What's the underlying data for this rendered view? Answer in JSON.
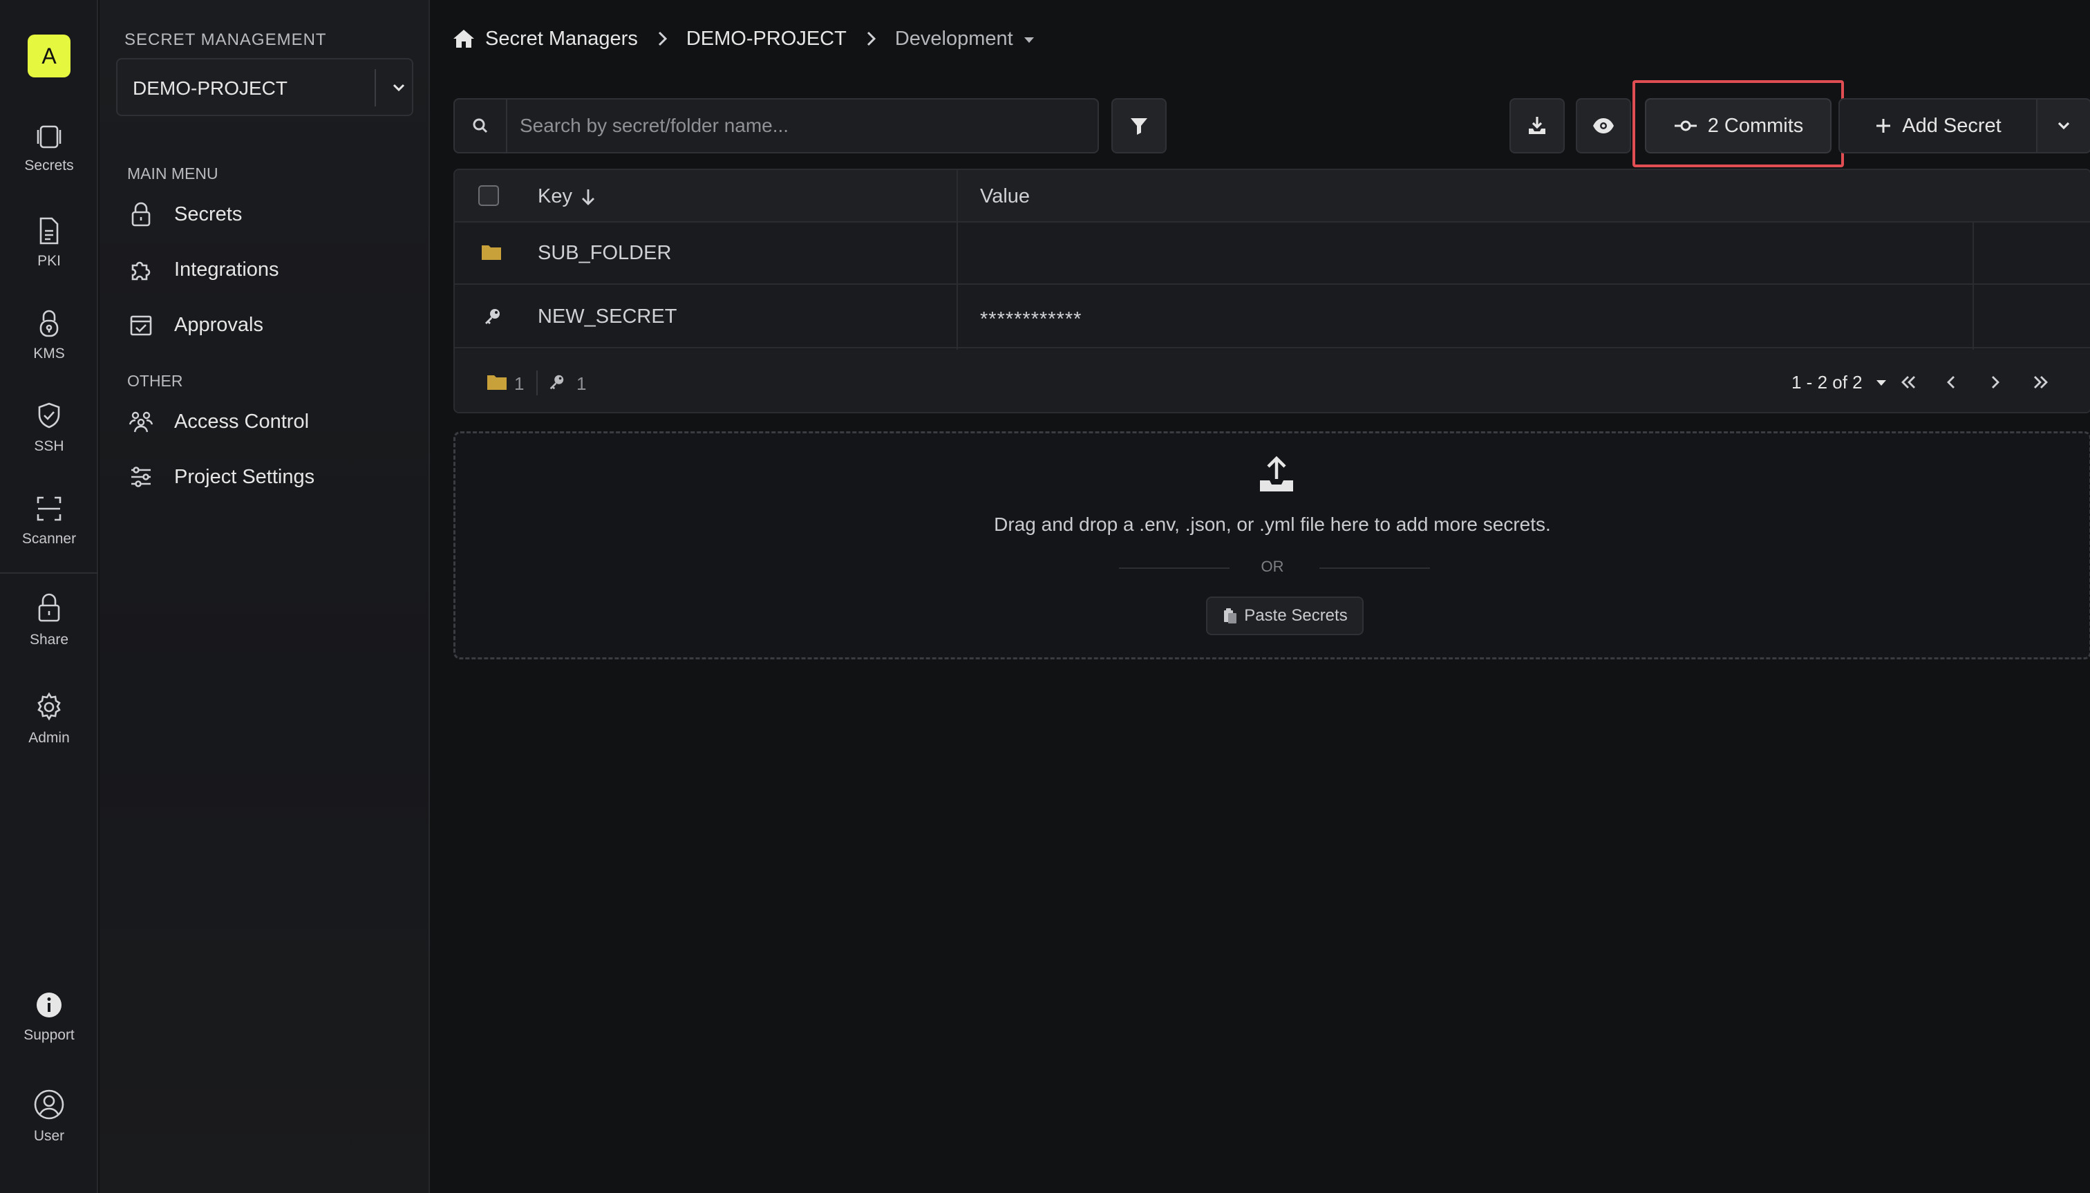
{
  "rail": {
    "logo_letter": "A",
    "items": [
      {
        "label": "Secrets",
        "icon": "secrets-icon"
      },
      {
        "label": "PKI",
        "icon": "document-icon"
      },
      {
        "label": "KMS",
        "icon": "lock-key-icon"
      },
      {
        "label": "SSH",
        "icon": "shield-icon"
      },
      {
        "label": "Scanner",
        "icon": "scan-icon"
      },
      {
        "label": "Share",
        "icon": "lock-icon"
      },
      {
        "label": "Admin",
        "icon": "gear-icon"
      },
      {
        "label": "Support",
        "icon": "info-icon"
      },
      {
        "label": "User",
        "icon": "user-icon"
      }
    ]
  },
  "sidebar": {
    "title": "SECRET MANAGEMENT",
    "project": "DEMO-PROJECT",
    "main_menu_label": "MAIN MENU",
    "main_menu": [
      {
        "label": "Secrets",
        "icon": "lock-icon"
      },
      {
        "label": "Integrations",
        "icon": "puzzle-icon"
      },
      {
        "label": "Approvals",
        "icon": "calendar-check-icon"
      }
    ],
    "other_label": "OTHER",
    "other_menu": [
      {
        "label": "Access Control",
        "icon": "users-icon"
      },
      {
        "label": "Project Settings",
        "icon": "sliders-icon"
      }
    ]
  },
  "breadcrumb": {
    "root": "Secret Managers",
    "project": "DEMO-PROJECT",
    "environment": "Development"
  },
  "toolbar": {
    "search_placeholder": "Search by secret/folder name...",
    "commits_label": "2 Commits",
    "add_secret_label": "Add Secret"
  },
  "table": {
    "columns": {
      "key": "Key",
      "value": "Value"
    },
    "rows": [
      {
        "type": "folder",
        "key": "SUB_FOLDER",
        "value": ""
      },
      {
        "type": "secret",
        "key": "NEW_SECRET",
        "value": "************"
      }
    ],
    "footer": {
      "folder_count": "1",
      "secret_count": "1",
      "range": "1 - 2 of 2"
    }
  },
  "dropzone": {
    "text": "Drag and drop a .env, .json, or .yml file here to add more secrets.",
    "or": "OR",
    "paste_label": "Paste Secrets"
  },
  "colors": {
    "accent": "#e5f73e",
    "highlight": "#e04d53",
    "folder": "#c9a13a"
  }
}
